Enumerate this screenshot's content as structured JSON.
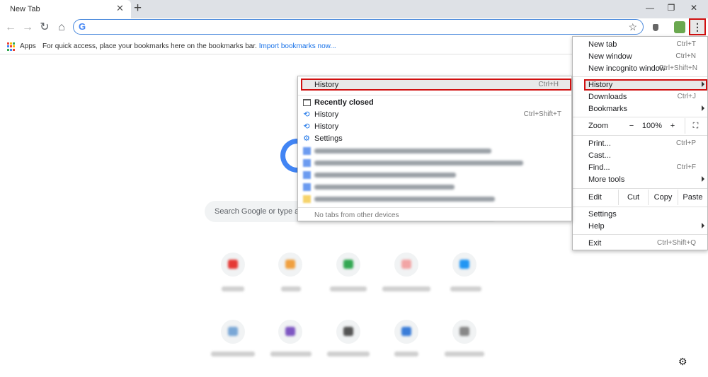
{
  "tabstrip": {
    "tab_title": "New Tab",
    "close_glyph": "✕",
    "new_tab_glyph": "+",
    "minimize_glyph": "—",
    "restore_glyph": "❐",
    "close_window_glyph": "✕"
  },
  "toolbar": {
    "back_glyph": "←",
    "forward_glyph": "→",
    "reload_glyph": "↻",
    "home_glyph": "⌂",
    "omnibox_logo": "G",
    "star_glyph": "☆",
    "menu_glyph": "⋮",
    "icons": [
      "back-arrow-icon",
      "forward-arrow-icon",
      "reload-icon",
      "home-icon",
      "google-g-icon",
      "star-icon",
      "shield-extension-icon",
      "android-extension-icon",
      "three-dots-menu-icon"
    ]
  },
  "bookmarks": {
    "apps_label": "Apps",
    "hint_text": "For quick access, place your bookmarks here on the bookmarks bar.",
    "import_link": "Import bookmarks now...",
    "apps_colors": [
      "#ea4335",
      "#fbbc05",
      "#34a853",
      "#4285f4",
      "#ea4335",
      "#fbbc05",
      "#34a853",
      "#4285f4",
      "#ea4335"
    ]
  },
  "ntp": {
    "search_placeholder": "Search Google or type a U",
    "gear_glyph": "⚙"
  },
  "chrome_menu": {
    "new_tab": {
      "label": "New tab",
      "shortcut": "Ctrl+T"
    },
    "new_window": {
      "label": "New window",
      "shortcut": "Ctrl+N"
    },
    "new_incognito": {
      "label": "New incognito window",
      "shortcut": "Ctrl+Shift+N"
    },
    "history": {
      "label": "History"
    },
    "downloads": {
      "label": "Downloads",
      "shortcut": "Ctrl+J"
    },
    "bookmarks": {
      "label": "Bookmarks"
    },
    "zoom": {
      "label": "Zoom",
      "minus": "−",
      "value": "100%",
      "plus": "+",
      "fullscreen": "⛶"
    },
    "print": {
      "label": "Print...",
      "shortcut": "Ctrl+P"
    },
    "cast": {
      "label": "Cast..."
    },
    "find": {
      "label": "Find...",
      "shortcut": "Ctrl+F"
    },
    "more_tools": {
      "label": "More tools"
    },
    "edit": {
      "label": "Edit",
      "cut": "Cut",
      "copy": "Copy",
      "paste": "Paste"
    },
    "settings": {
      "label": "Settings"
    },
    "help": {
      "label": "Help"
    },
    "exit": {
      "label": "Exit",
      "shortcut": "Ctrl+Shift+Q"
    }
  },
  "history_menu": {
    "history": {
      "label": "History",
      "shortcut": "Ctrl+H"
    },
    "recently_closed": "Recently closed",
    "item1": {
      "label": "History",
      "shortcut": "Ctrl+Shift+T"
    },
    "item2": {
      "label": "History"
    },
    "item3": {
      "label": "Settings"
    },
    "clock_glyph": "⟲",
    "gear_glyph": "⚙",
    "no_tabs_note": "No tabs from other devices"
  },
  "accent": {
    "highlight_border": "#d01010",
    "link_blue": "#1a73e8",
    "google_blue": "#4285f4"
  }
}
